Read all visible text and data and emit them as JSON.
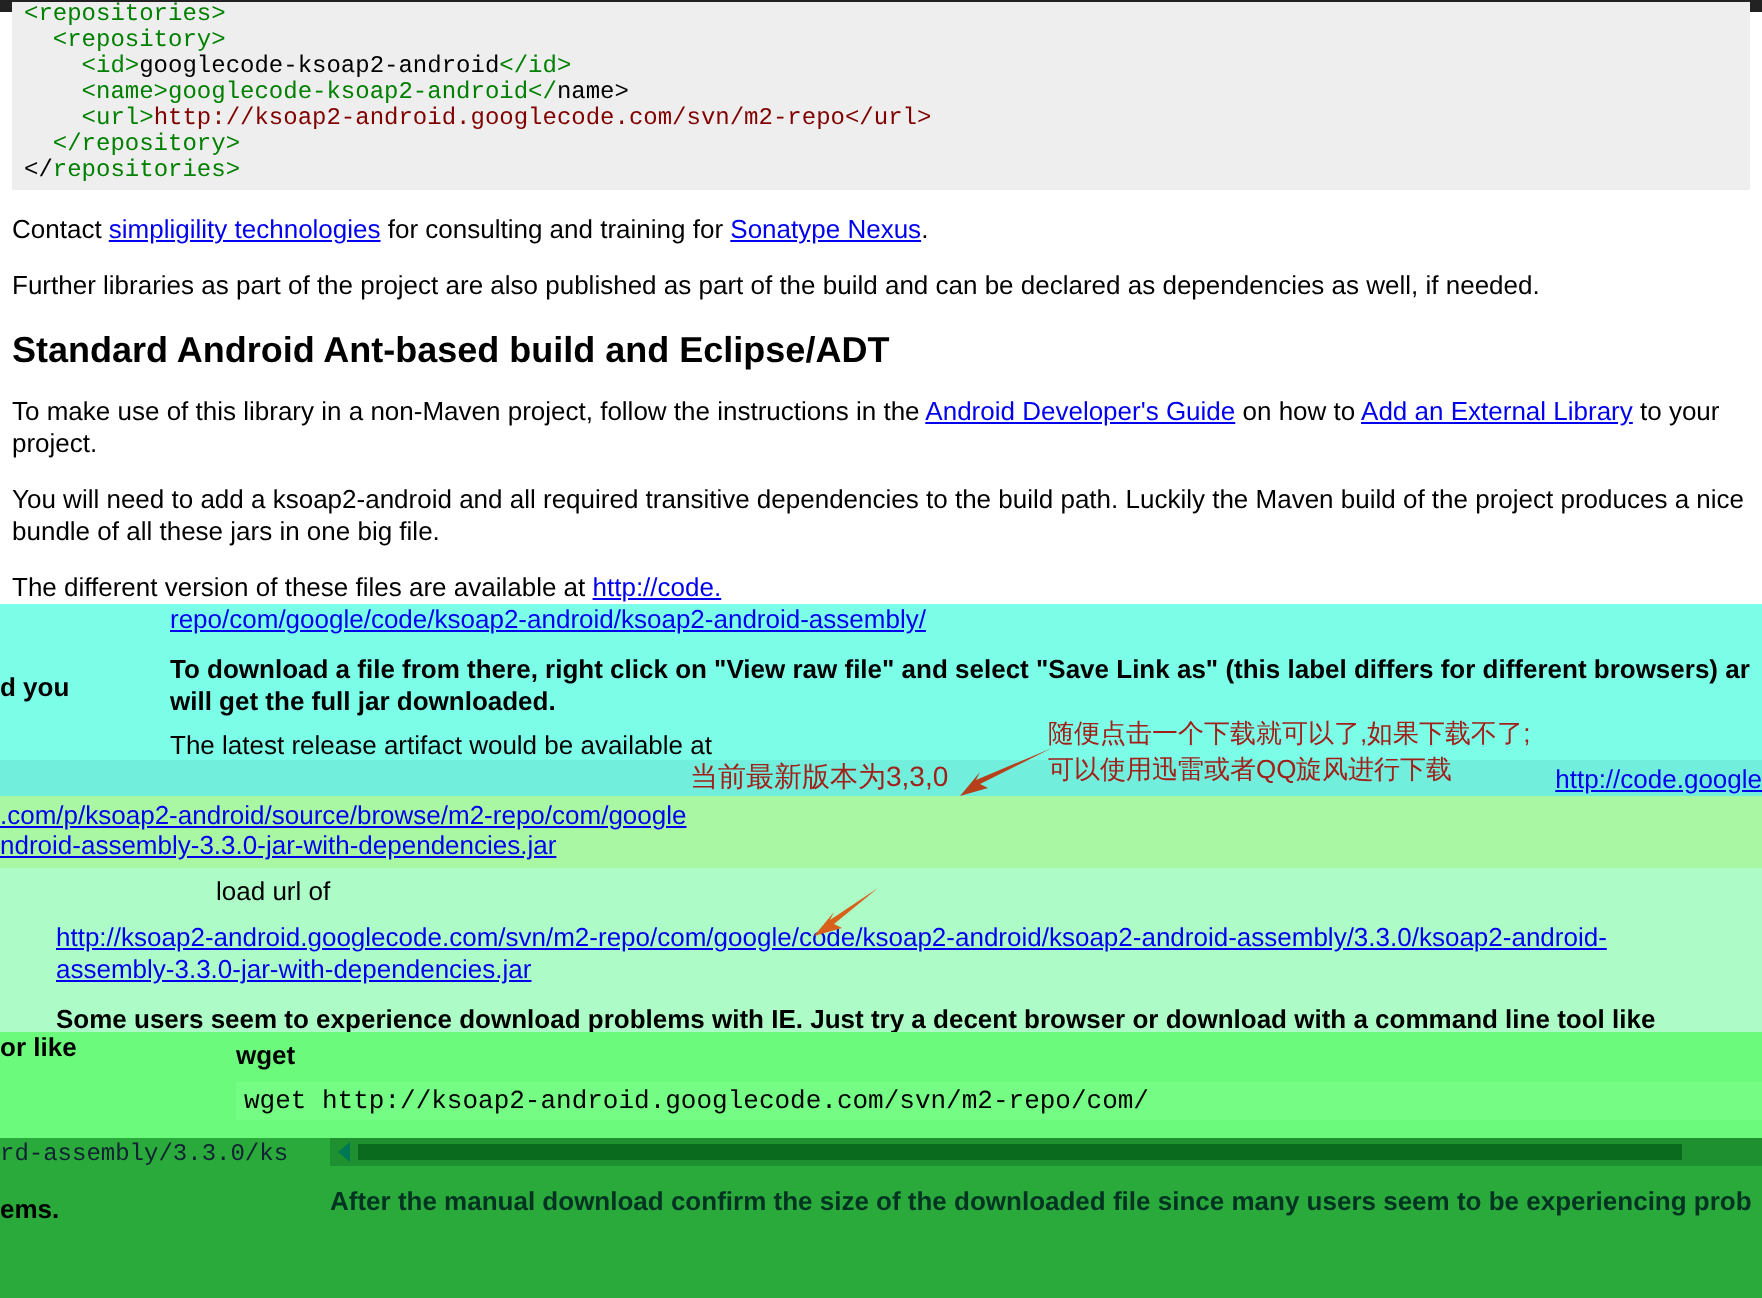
{
  "code_block": {
    "lines": [
      [
        {
          "kind": "tag",
          "text": "<repositories>"
        }
      ],
      [
        {
          "kind": "tag",
          "text": "  <repository>"
        }
      ],
      [
        {
          "kind": "tag",
          "text": "    <id>"
        },
        {
          "kind": "text",
          "text": "googlecode-ksoap2-android"
        },
        {
          "kind": "tag",
          "text": "</id>"
        }
      ],
      [
        {
          "kind": "tag",
          "text": "    <name>"
        },
        {
          "kind": "tag",
          "text": "googlecode-ksoap2-android"
        },
        {
          "kind": "tag",
          "text": "</"
        },
        {
          "kind": "text",
          "text": "name>"
        }
      ],
      [
        {
          "kind": "tag",
          "text": "    <url>"
        },
        {
          "kind": "url",
          "text": "http://ksoap2-android.googlecode.com/svn/m2-repo"
        },
        {
          "kind": "url",
          "text": "</url>"
        }
      ],
      [
        {
          "kind": "tag",
          "text": "  </repository>"
        }
      ],
      [
        {
          "kind": "text",
          "text": "</"
        },
        {
          "kind": "tag",
          "text": "repositories>"
        }
      ]
    ]
  },
  "contact": {
    "before": "Contact",
    "link1": "simpligility technologies",
    "middle": "for consulting and training for",
    "link2": "Sonatype Nexus",
    "after": "."
  },
  "further": "Further libraries as part of the project are also published as part of the build and can be declared as dependencies as well, if needed.",
  "heading": "Standard Android Ant-based build and Eclipse/ADT",
  "usage": {
    "before": "To make use of this library in a non-Maven project, follow the instructions in the",
    "link1": "Android Developer's Guide",
    "middle": "on how to",
    "link2": "Add an External Library",
    "after": "to your project."
  },
  "bundle": "You will need to add a ksoap2-android and all required transitive dependencies to the build path. Luckily the Maven build of the project produces a nice bundle of all these jars in one big file.",
  "versions": {
    "text": "The different version of these files are available at",
    "link": "http://code.",
    "link_cont": "repo/com/google/code/ksoap2-android/ksoap2-android-assembly/"
  },
  "cyan_band": {
    "left_fragment": "d you",
    "instruction": "To download a file from there, right click on \"View raw file\" and select \"Save Link as\" (this label differs for different browsers) ar will get the full jar downloaded.",
    "latest": "The latest release artifact would be available at",
    "note": [
      "随便点击一个下载就可以了,如果下载不了;",
      "可以使用迅雷或者QQ旋风进行下载"
    ]
  },
  "version_band": {
    "note": "当前最新版本为3,3,0",
    "right_link": "http://code.google"
  },
  "link_band": {
    "link": ".com/p/ksoap2-android/source/browse/m2-repo/com/google",
    "link_end": "ndroid-assembly-3.3.0-jar-with-dependencies.jar"
  },
  "pale_band": {
    "label": "load url of",
    "link": "http://ksoap2-android.googlecode.com/svn/m2-repo/com/google/code/ksoap2-android/ksoap2-android-assembly/3.3.0/ksoap2-android-assembly-3.3.0-jar-with-dependencies.jar",
    "warning": "Some users seem to experience download problems with IE. Just try a decent browser or download with a command line tool like"
  },
  "wget_band": {
    "left_fragment": "or like",
    "label": "wget",
    "command": "wget http://ksoap2-android.googlecode.com/svn/m2-repo/com/"
  },
  "bottom_band": {
    "left_fragment": "rd-assembly/3.3.0/ks",
    "left_end": "ems.",
    "after": "After the manual download confirm the size of the downloaded file since many users seem to be experiencing prob"
  }
}
